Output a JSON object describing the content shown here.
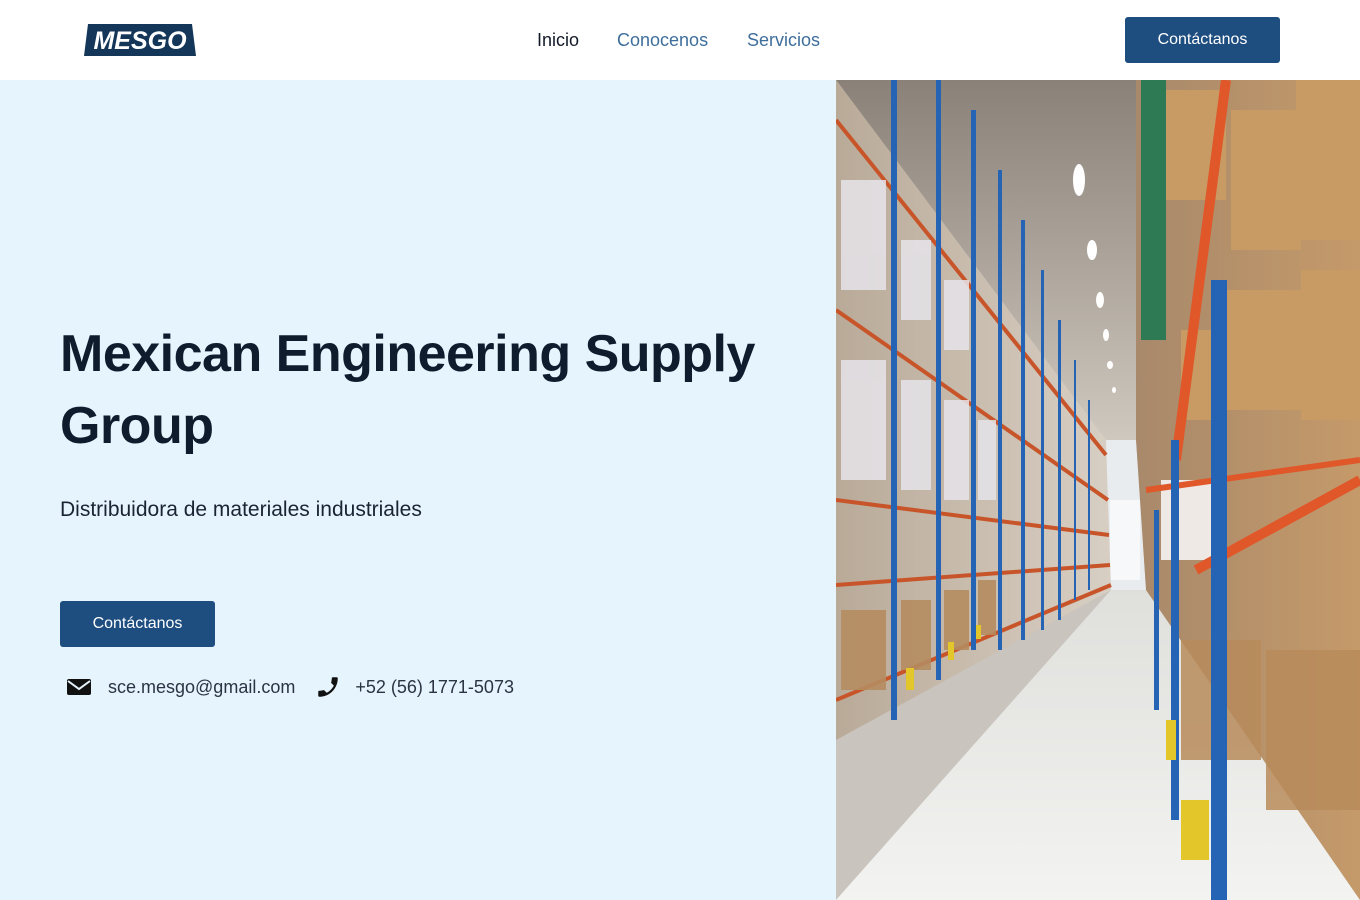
{
  "header": {
    "logo_text": "MESGO",
    "nav": [
      {
        "label": "Inicio",
        "active": true
      },
      {
        "label": "Conocenos",
        "active": false
      },
      {
        "label": "Servicios",
        "active": false
      }
    ],
    "cta_label": "Contáctanos"
  },
  "hero": {
    "title": "Mexican Engineering Supply Group",
    "subtitle": "Distribuidora de materiales industriales",
    "cta_label": "Contáctanos",
    "email": "sce.mesgo@gmail.com",
    "phone": "+52 (56) 1771-5073",
    "email_icon": "envelope-icon",
    "phone_icon": "phone-icon"
  },
  "colors": {
    "brand": "#1e4d7f",
    "logo": "#143659",
    "hero_background": "#e6f4fd",
    "nav_link": "#3e6e9c",
    "title": "#0f1c2e"
  }
}
